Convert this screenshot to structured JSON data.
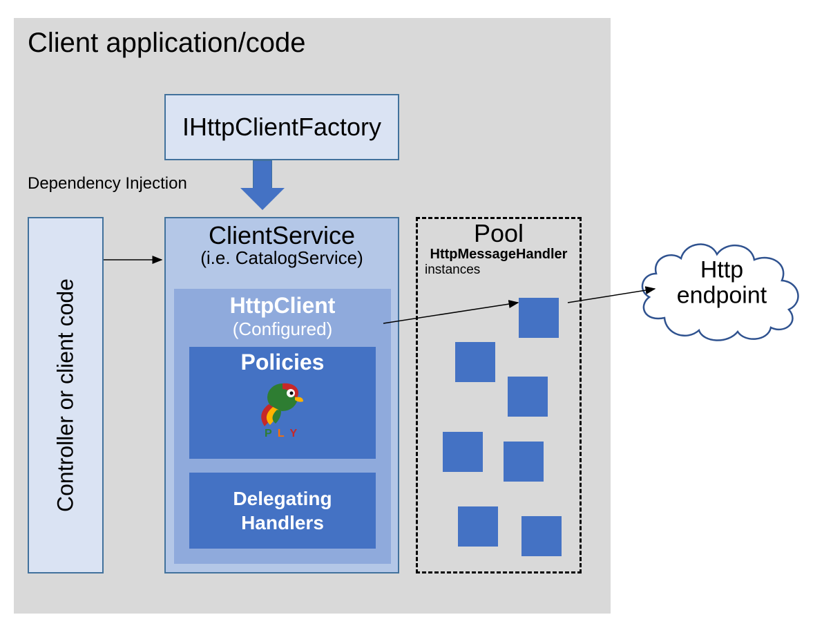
{
  "title": "Client application/code",
  "factory": {
    "label": "IHttpClientFactory"
  },
  "dep_injection_label": "Dependency Injection",
  "controller": {
    "label": "Controller or client code"
  },
  "client_service": {
    "title": "ClientService",
    "subtitle": "(i.e. CatalogService)",
    "http_client": {
      "title": "HttpClient",
      "subtitle": "(Configured)",
      "policies": {
        "label": "Policies",
        "polly_letters": [
          "P",
          "L",
          "Y"
        ]
      },
      "delegating": {
        "line1": "Delegating",
        "line2": "Handlers"
      }
    }
  },
  "pool": {
    "title": "Pool",
    "subtitle": "HttpMessageHandler",
    "subtitle2": "instances",
    "handler_count": 7
  },
  "endpoint": {
    "line1": "Http",
    "line2": "endpoint"
  },
  "colors": {
    "container_bg": "#d9d9d9",
    "light_blue": "#dae3f3",
    "mid_blue": "#b4c7e7",
    "accent_blue": "#8faadc",
    "dark_blue": "#4472c4",
    "border": "#41719c"
  }
}
